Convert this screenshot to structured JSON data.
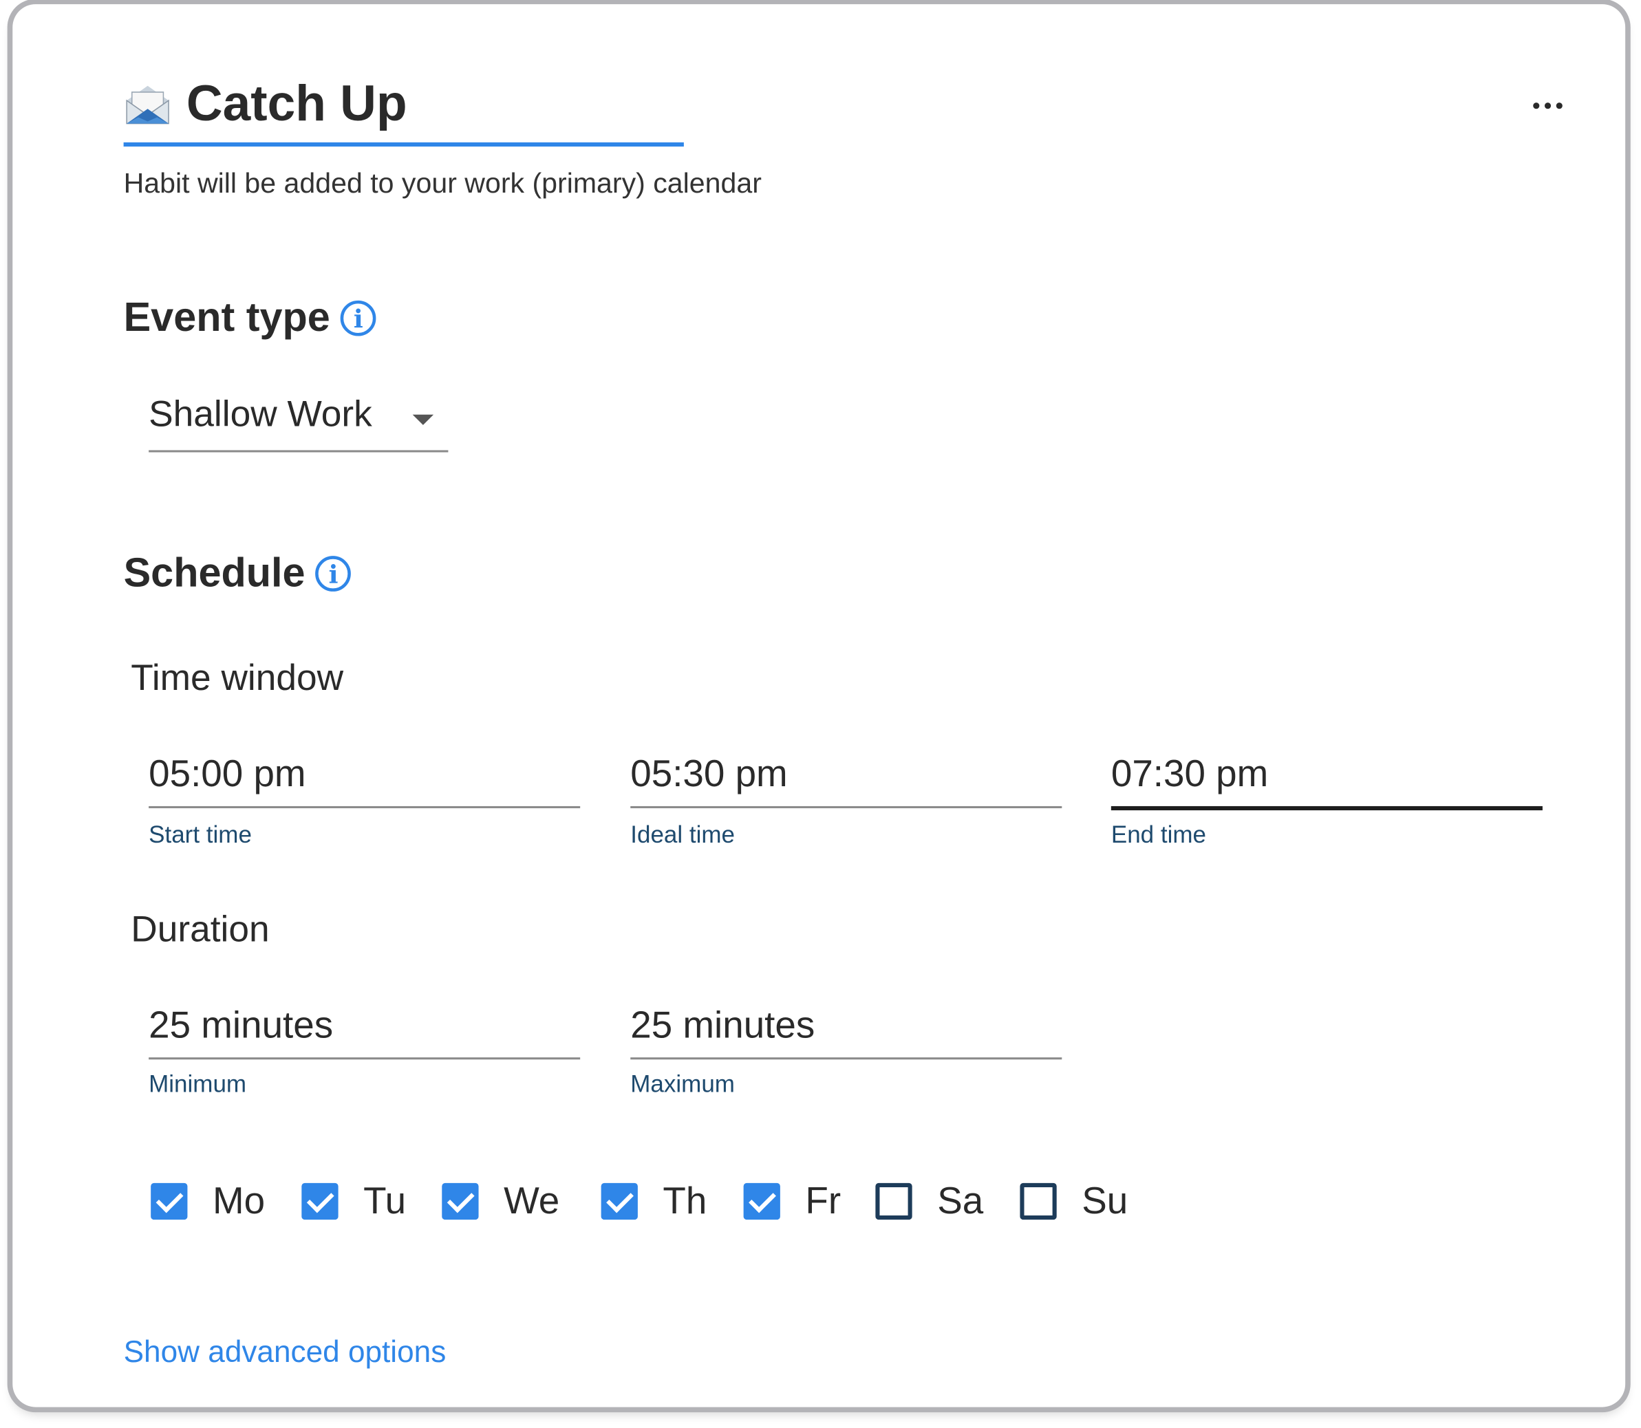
{
  "habit": {
    "title": "Catch Up",
    "calendar_note": "Habit will be added to your work (primary) calendar",
    "accent_color": "#2f86e8"
  },
  "event_type": {
    "heading": "Event type",
    "selected": "Shallow Work"
  },
  "schedule": {
    "heading": "Schedule",
    "time_window": {
      "label": "Time window",
      "start": {
        "value": "05:00 pm",
        "caption": "Start time"
      },
      "ideal": {
        "value": "05:30 pm",
        "caption": "Ideal time"
      },
      "end": {
        "value": "07:30 pm",
        "caption": "End time"
      }
    },
    "duration": {
      "label": "Duration",
      "minimum": {
        "value": "25 minutes",
        "caption": "Minimum"
      },
      "maximum": {
        "value": "25 minutes",
        "caption": "Maximum"
      }
    },
    "days": [
      {
        "label": "Mo",
        "checked": true
      },
      {
        "label": "Tu",
        "checked": true
      },
      {
        "label": "We",
        "checked": true
      },
      {
        "label": "Th",
        "checked": true
      },
      {
        "label": "Fr",
        "checked": true
      },
      {
        "label": "Sa",
        "checked": false
      },
      {
        "label": "Su",
        "checked": false
      }
    ]
  },
  "advanced_link": "Show advanced options"
}
